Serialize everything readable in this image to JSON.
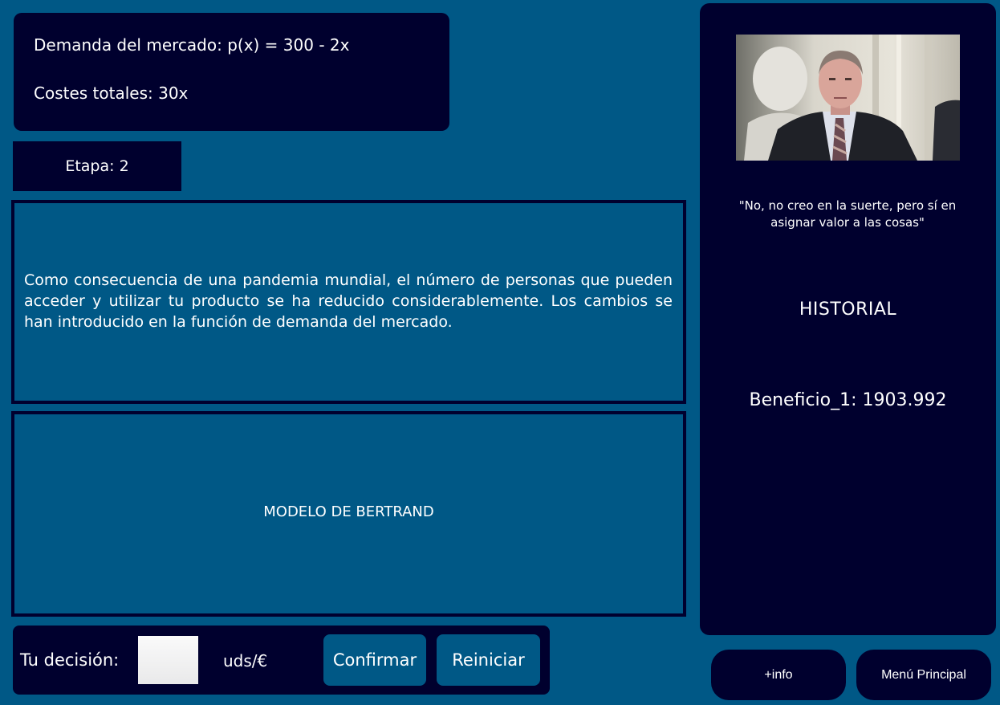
{
  "market": {
    "demand": "Demanda del mercado: p(x) = 300 - 2x",
    "costs": "Costes totales: 30x"
  },
  "stage": "Etapa: 2",
  "event_text": "Como consecuencia de una pandemia mundial, el número de personas que pueden acceder y utilizar tu producto se ha reducido considerablemente. Los cambios se han introducido en la función de demanda del mercado.",
  "model_title": "MODELO DE BERTRAND",
  "decision": {
    "label": "Tu decisión:",
    "input_value": "",
    "units": "uds/€",
    "confirm_label": "Confirmar",
    "reset_label": "Reiniciar"
  },
  "sidebar": {
    "quote": "\"No, no creo en la suerte, pero sí en asignar valor a las cosas\"",
    "historial_title": "HISTORIAL",
    "benefit": "Beneficio_1:  1903.992"
  },
  "buttons": {
    "info": "+info",
    "main_menu": "Menú Principal"
  },
  "colors": {
    "background": "#005886",
    "panel_dark": "#00002e",
    "text": "#ffffff"
  }
}
